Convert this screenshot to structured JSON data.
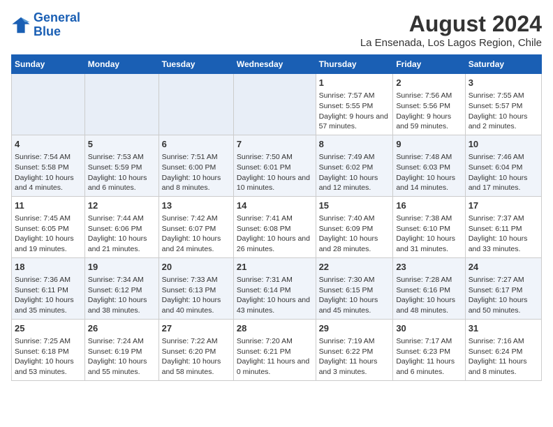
{
  "header": {
    "logo_line1": "General",
    "logo_line2": "Blue",
    "title": "August 2024",
    "subtitle": "La Ensenada, Los Lagos Region, Chile"
  },
  "days_of_week": [
    "Sunday",
    "Monday",
    "Tuesday",
    "Wednesday",
    "Thursday",
    "Friday",
    "Saturday"
  ],
  "weeks": [
    [
      {
        "day": "",
        "info": ""
      },
      {
        "day": "",
        "info": ""
      },
      {
        "day": "",
        "info": ""
      },
      {
        "day": "",
        "info": ""
      },
      {
        "day": "1",
        "info": "Sunrise: 7:57 AM\nSunset: 5:55 PM\nDaylight: 9 hours and 57 minutes."
      },
      {
        "day": "2",
        "info": "Sunrise: 7:56 AM\nSunset: 5:56 PM\nDaylight: 9 hours and 59 minutes."
      },
      {
        "day": "3",
        "info": "Sunrise: 7:55 AM\nSunset: 5:57 PM\nDaylight: 10 hours and 2 minutes."
      }
    ],
    [
      {
        "day": "4",
        "info": "Sunrise: 7:54 AM\nSunset: 5:58 PM\nDaylight: 10 hours and 4 minutes."
      },
      {
        "day": "5",
        "info": "Sunrise: 7:53 AM\nSunset: 5:59 PM\nDaylight: 10 hours and 6 minutes."
      },
      {
        "day": "6",
        "info": "Sunrise: 7:51 AM\nSunset: 6:00 PM\nDaylight: 10 hours and 8 minutes."
      },
      {
        "day": "7",
        "info": "Sunrise: 7:50 AM\nSunset: 6:01 PM\nDaylight: 10 hours and 10 minutes."
      },
      {
        "day": "8",
        "info": "Sunrise: 7:49 AM\nSunset: 6:02 PM\nDaylight: 10 hours and 12 minutes."
      },
      {
        "day": "9",
        "info": "Sunrise: 7:48 AM\nSunset: 6:03 PM\nDaylight: 10 hours and 14 minutes."
      },
      {
        "day": "10",
        "info": "Sunrise: 7:46 AM\nSunset: 6:04 PM\nDaylight: 10 hours and 17 minutes."
      }
    ],
    [
      {
        "day": "11",
        "info": "Sunrise: 7:45 AM\nSunset: 6:05 PM\nDaylight: 10 hours and 19 minutes."
      },
      {
        "day": "12",
        "info": "Sunrise: 7:44 AM\nSunset: 6:06 PM\nDaylight: 10 hours and 21 minutes."
      },
      {
        "day": "13",
        "info": "Sunrise: 7:42 AM\nSunset: 6:07 PM\nDaylight: 10 hours and 24 minutes."
      },
      {
        "day": "14",
        "info": "Sunrise: 7:41 AM\nSunset: 6:08 PM\nDaylight: 10 hours and 26 minutes."
      },
      {
        "day": "15",
        "info": "Sunrise: 7:40 AM\nSunset: 6:09 PM\nDaylight: 10 hours and 28 minutes."
      },
      {
        "day": "16",
        "info": "Sunrise: 7:38 AM\nSunset: 6:10 PM\nDaylight: 10 hours and 31 minutes."
      },
      {
        "day": "17",
        "info": "Sunrise: 7:37 AM\nSunset: 6:11 PM\nDaylight: 10 hours and 33 minutes."
      }
    ],
    [
      {
        "day": "18",
        "info": "Sunrise: 7:36 AM\nSunset: 6:11 PM\nDaylight: 10 hours and 35 minutes."
      },
      {
        "day": "19",
        "info": "Sunrise: 7:34 AM\nSunset: 6:12 PM\nDaylight: 10 hours and 38 minutes."
      },
      {
        "day": "20",
        "info": "Sunrise: 7:33 AM\nSunset: 6:13 PM\nDaylight: 10 hours and 40 minutes."
      },
      {
        "day": "21",
        "info": "Sunrise: 7:31 AM\nSunset: 6:14 PM\nDaylight: 10 hours and 43 minutes."
      },
      {
        "day": "22",
        "info": "Sunrise: 7:30 AM\nSunset: 6:15 PM\nDaylight: 10 hours and 45 minutes."
      },
      {
        "day": "23",
        "info": "Sunrise: 7:28 AM\nSunset: 6:16 PM\nDaylight: 10 hours and 48 minutes."
      },
      {
        "day": "24",
        "info": "Sunrise: 7:27 AM\nSunset: 6:17 PM\nDaylight: 10 hours and 50 minutes."
      }
    ],
    [
      {
        "day": "25",
        "info": "Sunrise: 7:25 AM\nSunset: 6:18 PM\nDaylight: 10 hours and 53 minutes."
      },
      {
        "day": "26",
        "info": "Sunrise: 7:24 AM\nSunset: 6:19 PM\nDaylight: 10 hours and 55 minutes."
      },
      {
        "day": "27",
        "info": "Sunrise: 7:22 AM\nSunset: 6:20 PM\nDaylight: 10 hours and 58 minutes."
      },
      {
        "day": "28",
        "info": "Sunrise: 7:20 AM\nSunset: 6:21 PM\nDaylight: 11 hours and 0 minutes."
      },
      {
        "day": "29",
        "info": "Sunrise: 7:19 AM\nSunset: 6:22 PM\nDaylight: 11 hours and 3 minutes."
      },
      {
        "day": "30",
        "info": "Sunrise: 7:17 AM\nSunset: 6:23 PM\nDaylight: 11 hours and 6 minutes."
      },
      {
        "day": "31",
        "info": "Sunrise: 7:16 AM\nSunset: 6:24 PM\nDaylight: 11 hours and 8 minutes."
      }
    ]
  ]
}
